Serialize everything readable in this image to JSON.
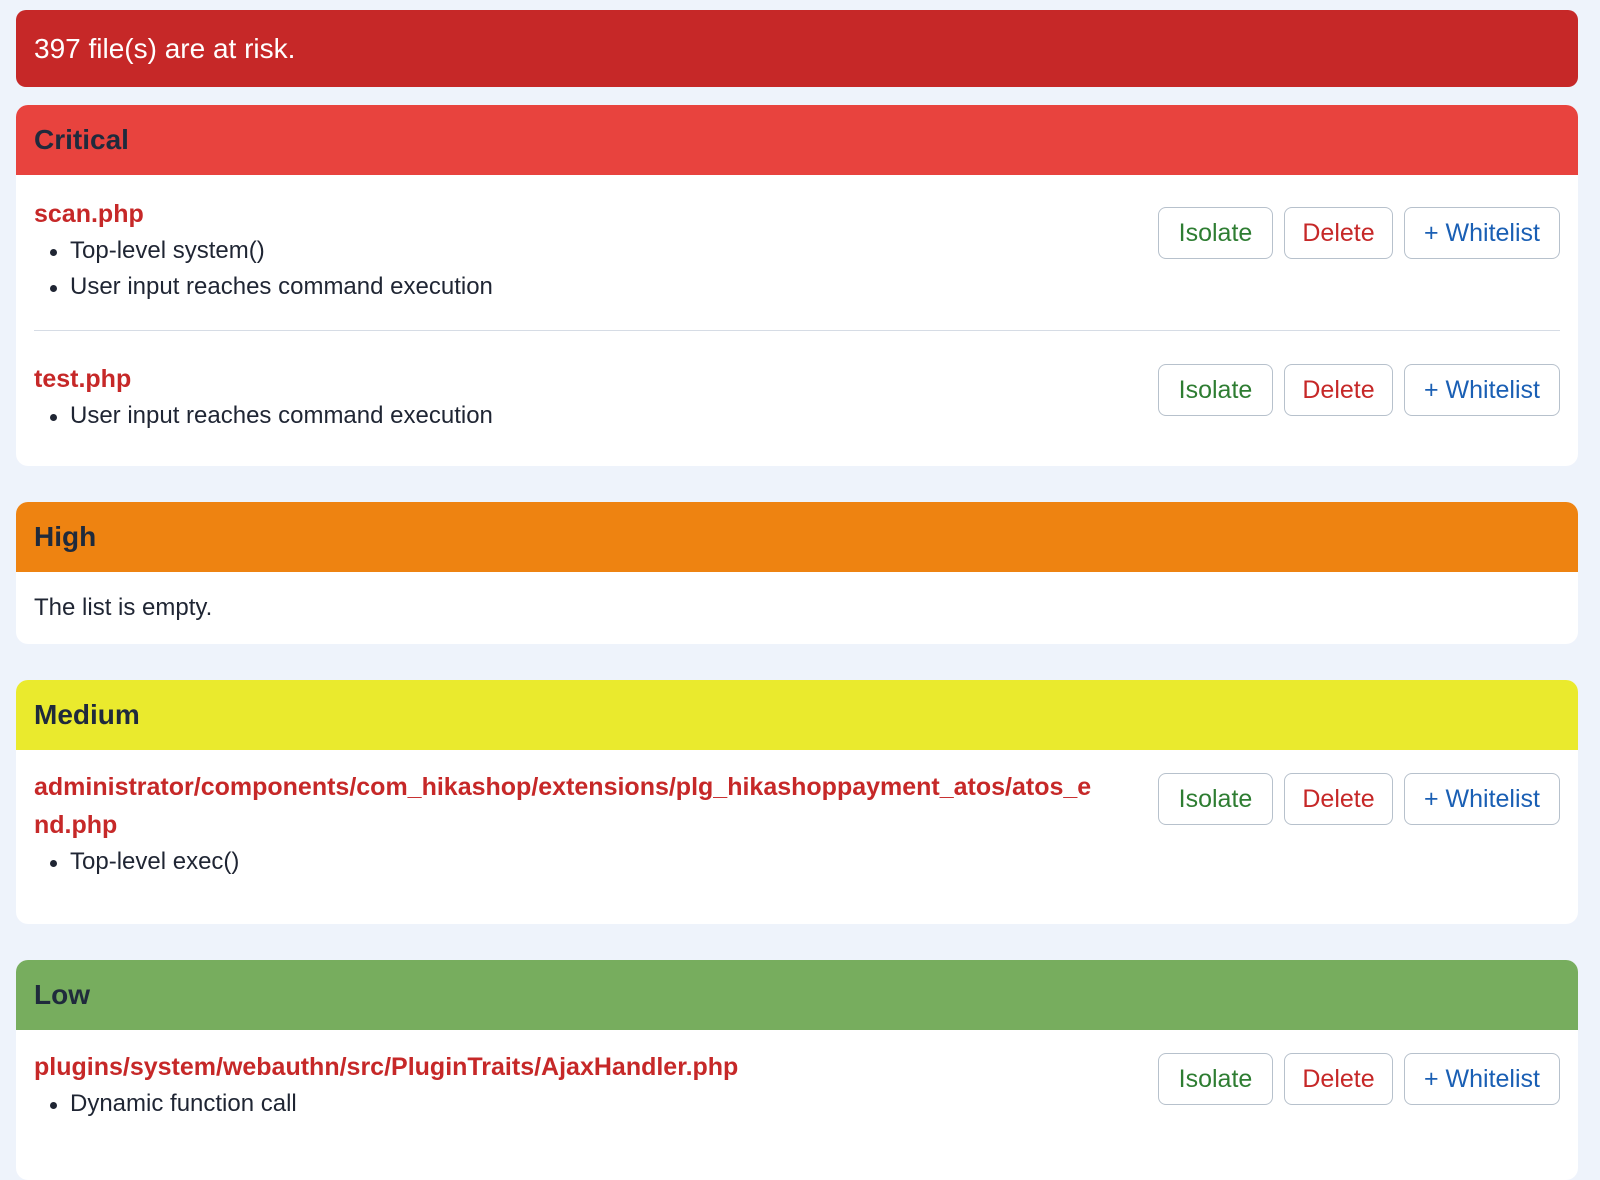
{
  "alert": {
    "text": "397 file(s) are at risk."
  },
  "buttons": {
    "isolate": "Isolate",
    "delete": "Delete",
    "whitelist": "+ Whitelist"
  },
  "sections": {
    "critical": {
      "title": "Critical",
      "color": "#e8433e",
      "files": [
        {
          "name": "scan.php",
          "reasons": [
            "Top-level system()",
            "User input reaches command execution"
          ]
        },
        {
          "name": "test.php",
          "reasons": [
            "User input reaches command execution"
          ]
        }
      ]
    },
    "high": {
      "title": "High",
      "color": "#ee8311",
      "empty_text": "The list is empty."
    },
    "medium": {
      "title": "Medium",
      "color": "#eaea2d",
      "files": [
        {
          "name": "administrator/components/com_hikashop/extensions/plg_hikashoppayment_atos/atos_end.php",
          "reasons": [
            "Top-level exec()"
          ]
        }
      ]
    },
    "low": {
      "title": "Low",
      "color": "#77ad5e",
      "files": [
        {
          "name": "plugins/system/webauthn/src/PluginTraits/AjaxHandler.php",
          "reasons": [
            "Dynamic function call"
          ]
        }
      ]
    }
  }
}
